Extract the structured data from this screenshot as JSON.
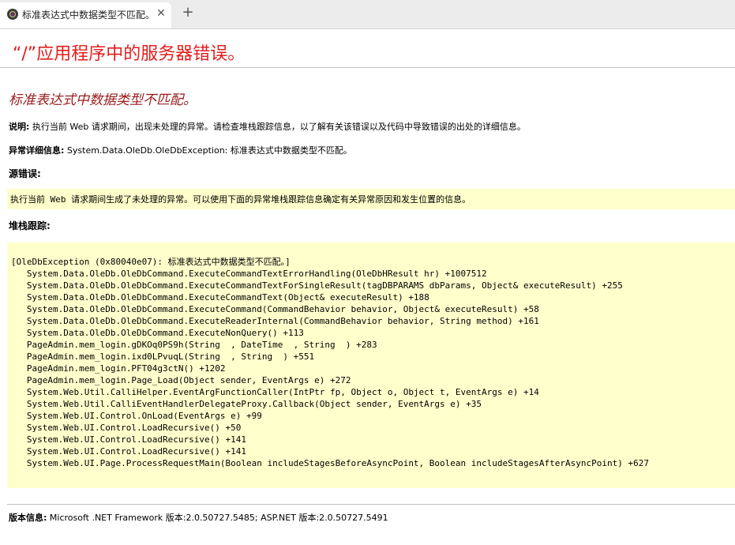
{
  "browser": {
    "tab_title": "标准表达式中数据类型不匹配。",
    "close_glyph": "✕",
    "newtab_glyph": "+",
    "icons": {
      "favicon": "app-favicon",
      "close": "close-icon",
      "add": "plus-icon"
    }
  },
  "page": {
    "title": "“/”应用程序中的服务器错误。",
    "subtitle": "标准表达式中数据类型不匹配。",
    "description_label": "说明:",
    "description_text": "执行当前 Web 请求期间，出现未处理的异常。请检查堆栈跟踪信息，以了解有关该错误以及代码中导致错误的出处的详细信息。",
    "exception_label": "异常详细信息:",
    "exception_text": "System.Data.OleDb.OleDbException: 标准表达式中数据类型不匹配。",
    "source_label": "源错误:",
    "source_text": "执行当前 Web 请求期间生成了未处理的异常。可以使用下面的异常堆栈跟踪信息确定有关异常原因和发生位置的信息。",
    "stack_label": "堆栈跟踪:",
    "stack_lines": [
      "[OleDbException (0x80040e07): 标准表达式中数据类型不匹配。]",
      "   System.Data.OleDb.OleDbCommand.ExecuteCommandTextErrorHandling(OleDbHResult hr) +1007512",
      "   System.Data.OleDb.OleDbCommand.ExecuteCommandTextForSingleResult(tagDBPARAMS dbParams, Object& executeResult) +255",
      "   System.Data.OleDb.OleDbCommand.ExecuteCommandText(Object& executeResult) +188",
      "   System.Data.OleDb.OleDbCommand.ExecuteCommand(CommandBehavior behavior, Object& executeResult) +58",
      "   System.Data.OleDb.OleDbCommand.ExecuteReaderInternal(CommandBehavior behavior, String method) +161",
      "   System.Data.OleDb.OleDbCommand.ExecuteNonQuery() +113",
      "   PageAdmin.mem_login.gDKOq0PS9h(String  , DateTime  , String  ) +283",
      "   PageAdmin.mem_login.ixd0LPvuqL(String  , String  ) +551",
      "   PageAdmin.mem_login.PFT04g3ctN() +1202",
      "   PageAdmin.mem_login.Page_Load(Object sender, EventArgs e) +272",
      "   System.Web.Util.CalliHelper.EventArgFunctionCaller(IntPtr fp, Object o, Object t, EventArgs e) +14",
      "   System.Web.Util.CalliEventHandlerDelegateProxy.Callback(Object sender, EventArgs e) +35",
      "   System.Web.UI.Control.OnLoad(EventArgs e) +99",
      "   System.Web.UI.Control.LoadRecursive() +50",
      "   System.Web.UI.Control.LoadRecursive() +141",
      "   System.Web.UI.Control.LoadRecursive() +141",
      "   System.Web.UI.Page.ProcessRequestMain(Boolean includeStagesBeforeAsyncPoint, Boolean includeStagesAfterAsyncPoint) +627"
    ],
    "version_label": "版本信息:",
    "version_text": "Microsoft .NET Framework 版本:2.0.50727.5485; ASP.NET 版本:2.0.50727.5491"
  },
  "colors": {
    "title": "#e41d1d",
    "subtitle": "#9b1c1c",
    "code_background": "#ffffcc"
  }
}
